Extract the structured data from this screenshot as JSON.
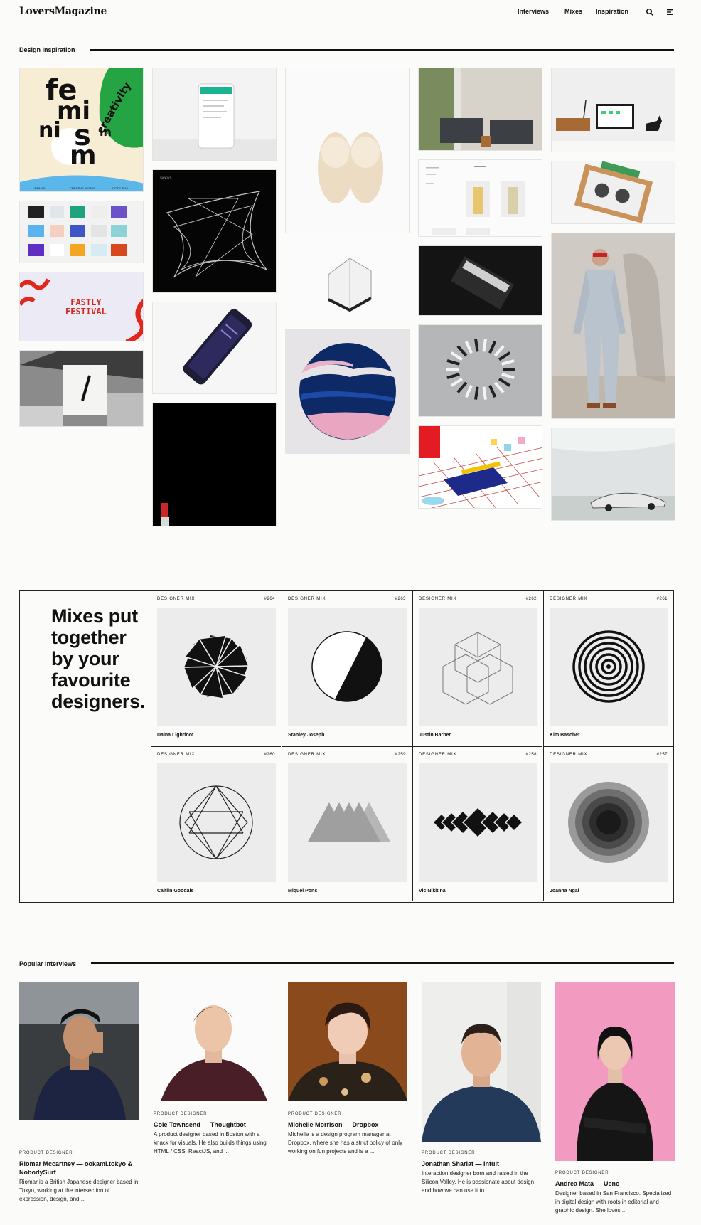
{
  "header": {
    "logo": "LoversMagazine",
    "nav": [
      "Interviews",
      "Mixes",
      "Inspiration"
    ]
  },
  "inspiration": {
    "title": "Design Inspiration",
    "feminism_text": [
      "fe",
      "mi",
      "ni",
      "s",
      "m",
      "in",
      "creativity"
    ],
    "feminism_footer": [
      "A PANEL",
      "CREATIVE WORKS",
      "OCT 7 2018"
    ],
    "fastly_text": [
      "FASTLY",
      "FESTIVAL"
    ],
    "card_label": "SANDYS"
  },
  "mixes": {
    "heading": [
      "Mixes put",
      "together",
      "by your",
      "favourite",
      "designers."
    ],
    "label": "DESIGNER MIX",
    "items": [
      {
        "num": "#264",
        "name": "Daina Lightfoot"
      },
      {
        "num": "#263",
        "name": "Stanley Joseph"
      },
      {
        "num": "#262",
        "name": "Justin Barber"
      },
      {
        "num": "#261",
        "name": "Kim Baschet"
      },
      {
        "num": "#260",
        "name": "Caitlin Goodale"
      },
      {
        "num": "#259",
        "name": "Miquel Pons"
      },
      {
        "num": "#258",
        "name": "Vic Nikitina"
      },
      {
        "num": "#257",
        "name": "Joanna Ngai"
      }
    ]
  },
  "interviews": {
    "title": "Popular Interviews",
    "items": [
      {
        "kicker": "PRODUCT DESIGNER",
        "title": "Riomar Mccartney — ookami.tokyo & NobodySurf",
        "desc": "Riomar is a British Japanese designer based in Tokyo, working at the intersection of expression, design, and ..."
      },
      {
        "kicker": "PRODUCT DESIGNER",
        "title": "Cole Townsend — Thoughtbot",
        "desc": "A product designer based in Boston with a knack for visuals. He also builds things using HTML / CSS, ReactJS, and ..."
      },
      {
        "kicker": "PRODUCT DESIGNER",
        "title": "Michelle Morrison — Dropbox",
        "desc": "Michelle is a design program manager at Dropbox, where she has a strict policy of only working on fun projects and is a ..."
      },
      {
        "kicker": "PRODUCT DESIGNER",
        "title": "Jonathan Shariat — Intuit",
        "desc": "Interaction designer born and raised in the Silicon Valley. He is passionate about design and how we can use it to ..."
      },
      {
        "kicker": "PRODUCT DESIGNER",
        "title": "Andrea Mata — Ueno",
        "desc": "Designer based in San Francisco. Specialized in digital design with roots in editorial and graphic design. She loves ..."
      }
    ]
  }
}
